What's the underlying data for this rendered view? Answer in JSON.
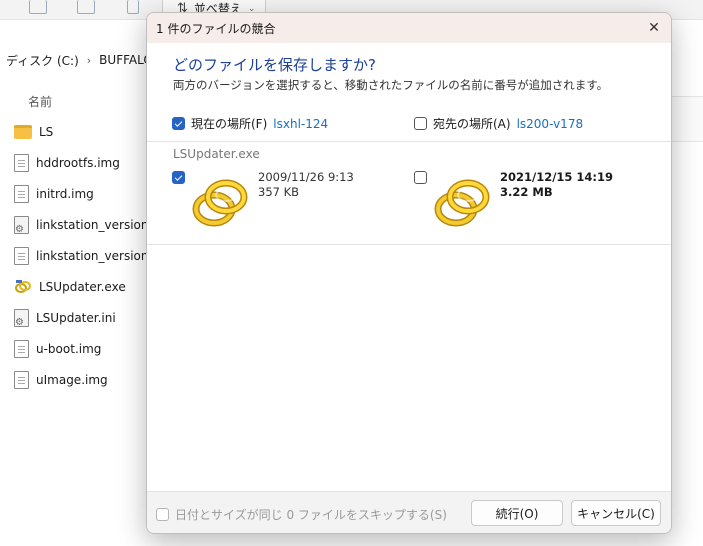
{
  "explorer": {
    "sort_label": "並べ替え",
    "breadcrumb": [
      "ディスク (C:)",
      "BUFFALO"
    ],
    "column_header": "名前",
    "files": [
      {
        "name": "LS",
        "icon": "folder-icon"
      },
      {
        "name": "hddrootfs.img",
        "icon": "document-icon"
      },
      {
        "name": "initrd.img",
        "icon": "document-icon"
      },
      {
        "name": "linkstation_version.ini",
        "icon": "settings-file-icon"
      },
      {
        "name": "linkstation_version.txt",
        "icon": "document-icon"
      },
      {
        "name": "LSUpdater.exe",
        "icon": "rings-icon"
      },
      {
        "name": "LSUpdater.ini",
        "icon": "settings-file-icon"
      },
      {
        "name": "u-boot.img",
        "icon": "document-icon"
      },
      {
        "name": "uImage.img",
        "icon": "document-icon"
      }
    ]
  },
  "dialog": {
    "title": "1 件のファイルの競合",
    "close_glyph": "✕",
    "heading": "どのファイルを保存しますか?",
    "subtext": "両方のバージョンを選択すると、移動されたファイルの名前に番号が追加されます。",
    "current": {
      "label": "現在の場所(F)",
      "location": "lsxhl-124",
      "checked": true
    },
    "destination": {
      "label": "宛先の場所(A)",
      "location": "ls200-v178",
      "checked": false
    },
    "file_name": "LSUpdater.exe",
    "left_file": {
      "date": "2009/11/26 9:13",
      "size": "357 KB"
    },
    "right_file": {
      "date": "2021/12/15 14:19",
      "size": "3.22 MB"
    },
    "skip_label": "日付とサイズが同じ 0 ファイルをスキップする(S)",
    "continue_label": "続行(O)",
    "cancel_label": "キャンセル(C)"
  },
  "colors": {
    "accent": "#2563c4",
    "heading": "#1b3f9a",
    "link": "#1a6fc4",
    "titlebar": "#f6ecea"
  }
}
